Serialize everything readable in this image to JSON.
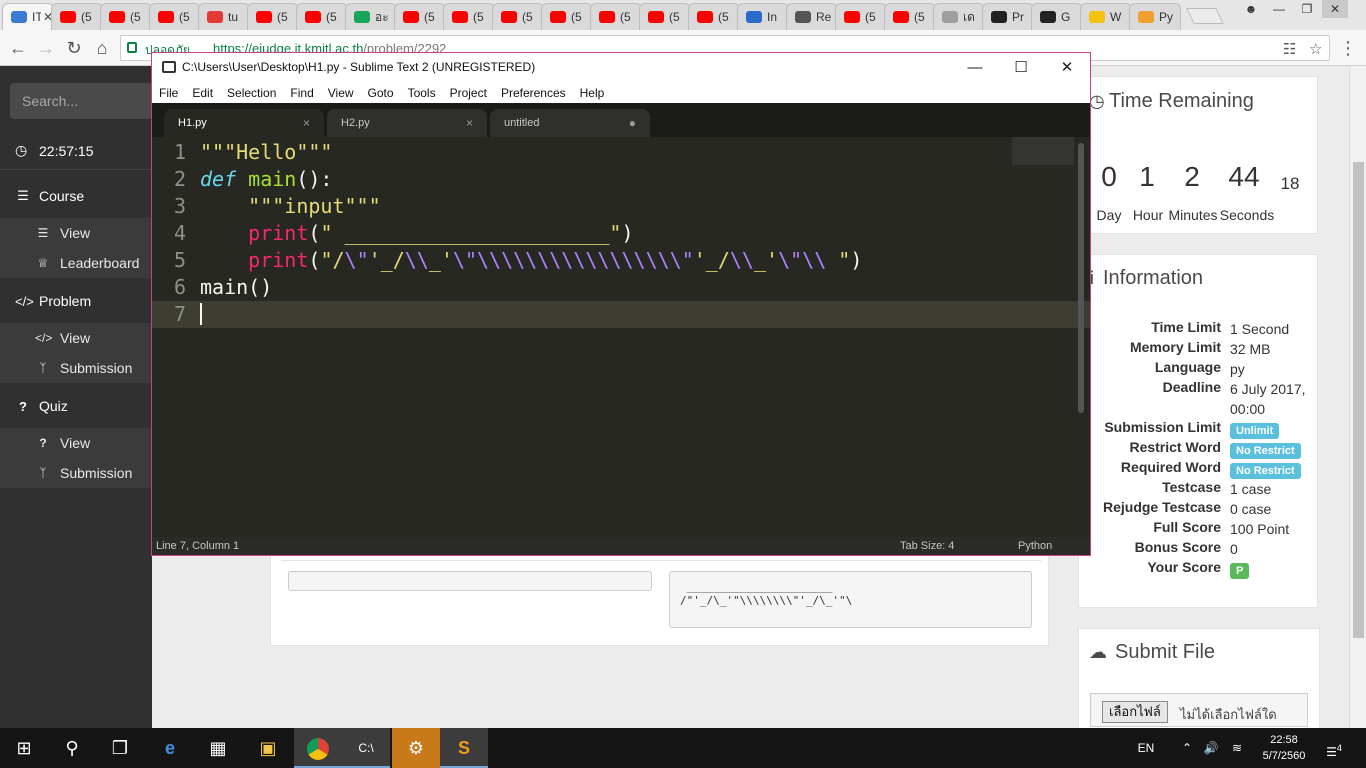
{
  "browser": {
    "tabs": [
      {
        "label": "IT",
        "icon": "it-favicon",
        "active": true,
        "color": "#3a7bd5"
      },
      {
        "label": "(5",
        "icon": "youtube-icon",
        "color": "#ff0000"
      },
      {
        "label": "(5",
        "icon": "youtube-icon",
        "color": "#ff0000"
      },
      {
        "label": "(5",
        "icon": "youtube-icon",
        "color": "#ff0000"
      },
      {
        "label": "tu",
        "icon": "pdf-icon",
        "color": "#e53935"
      },
      {
        "label": "(5",
        "icon": "youtube-icon",
        "color": "#ff0000"
      },
      {
        "label": "(5",
        "icon": "youtube-icon",
        "color": "#ff0000"
      },
      {
        "label": "อะ",
        "icon": "n-icon",
        "color": "#18a558"
      },
      {
        "label": "(5",
        "icon": "youtube-icon",
        "color": "#ff0000"
      },
      {
        "label": "(5",
        "icon": "youtube-icon",
        "color": "#ff0000"
      },
      {
        "label": "(5",
        "icon": "youtube-icon",
        "color": "#ff0000"
      },
      {
        "label": "(5",
        "icon": "youtube-icon",
        "color": "#ff0000"
      },
      {
        "label": "(5",
        "icon": "youtube-icon",
        "color": "#ff0000"
      },
      {
        "label": "(5",
        "icon": "youtube-icon",
        "color": "#ff0000"
      },
      {
        "label": "(5",
        "icon": "youtube-icon",
        "color": "#ff0000"
      },
      {
        "label": "In",
        "icon": "ox-icon",
        "color": "#2a6ac8"
      },
      {
        "label": "Re",
        "icon": "reader-icon",
        "color": "#555555"
      },
      {
        "label": "(5",
        "icon": "youtube-icon",
        "color": "#ff0000"
      },
      {
        "label": "(5",
        "icon": "youtube-icon",
        "color": "#ff0000"
      },
      {
        "label": "เด",
        "icon": "document-icon",
        "color": "#9e9e9e"
      },
      {
        "label": "Pr",
        "icon": "github-icon",
        "color": "#222222"
      },
      {
        "label": "G",
        "icon": "github-icon",
        "color": "#222222"
      },
      {
        "label": "W",
        "icon": "emoji-icon",
        "color": "#f4c20d"
      },
      {
        "label": "Py",
        "icon": "python-icon",
        "color": "#f0a030"
      }
    ],
    "secure_label": "ปลอดภัย",
    "url_host": "https://ejudge.it.kmitl.ac.th",
    "url_path": "/problem/2292"
  },
  "sidebar": {
    "search_placeholder": "Search...",
    "clock": "22:57:15",
    "sections": [
      {
        "label": "Course",
        "icon": "list-icon",
        "items": [
          {
            "label": "View",
            "icon": "list-icon"
          },
          {
            "label": "Leaderboard",
            "icon": "trophy-icon"
          }
        ]
      },
      {
        "label": "Problem",
        "icon": "code-icon",
        "items": [
          {
            "label": "View",
            "icon": "code-icon"
          },
          {
            "label": "Submission",
            "icon": "branch-icon"
          }
        ]
      },
      {
        "label": "Quiz",
        "icon": "question-icon",
        "items": [
          {
            "label": "View",
            "icon": "question-icon"
          },
          {
            "label": "Submission",
            "icon": "branch-icon"
          }
        ]
      }
    ]
  },
  "content": {
    "output_text": " ______________________\n/\"'_/\\_'\"\\\\\\\\\\\\\\\\\"'_/\\_'\"\\"
  },
  "time_remaining": {
    "title": "Time Remaining",
    "day": "0",
    "hour": "1",
    "minutes": "2",
    "seconds": "44",
    "small": "18",
    "day_label": "Day",
    "hour_label": "Hour",
    "minutes_label": "Minutes",
    "seconds_label": "Seconds"
  },
  "information": {
    "title": "Information",
    "rows": [
      {
        "key": "Time Limit",
        "value": "1 Second"
      },
      {
        "key": "Memory Limit",
        "value": "32 MB"
      },
      {
        "key": "Language",
        "value": "py"
      },
      {
        "key": "Deadline",
        "value": "6 July 2017,",
        "value2": "00:00"
      },
      {
        "key": "Submission Limit",
        "badge": "Unlimit"
      },
      {
        "key": "Restrict Word",
        "badge": "No Restrict"
      },
      {
        "key": "Required Word",
        "badge": "No Restrict"
      },
      {
        "key": "Testcase",
        "value": "1 case"
      },
      {
        "key": "Rejudge Testcase",
        "value": "0 case"
      },
      {
        "key": "Full Score",
        "value": "100 Point"
      },
      {
        "key": "Bonus Score",
        "value": "0"
      },
      {
        "key": "Your Score",
        "badge_green": "P"
      }
    ]
  },
  "submit": {
    "title": "Submit File",
    "choose_button": "เลือกไฟล์",
    "no_file": "ไม่ได้เลือกไฟล์ใด"
  },
  "sublime": {
    "title": "C:\\Users\\User\\Desktop\\H1.py - Sublime Text 2 (UNREGISTERED)",
    "menu": [
      "File",
      "Edit",
      "Selection",
      "Find",
      "View",
      "Goto",
      "Tools",
      "Project",
      "Preferences",
      "Help"
    ],
    "tabs": [
      {
        "label": "H1.py",
        "close": "×",
        "active": true
      },
      {
        "label": "H2.py",
        "close": "×"
      },
      {
        "label": "untitled",
        "close": "●"
      }
    ],
    "line_numbers": [
      "1",
      "2",
      "3",
      "4",
      "5",
      "6",
      "7"
    ],
    "code": {
      "l1": "\"\"\"Hello\"\"\"",
      "l2_kw": "def",
      "l2_fn": "main",
      "l2_rest": "():",
      "l3": "\"\"\"input\"\"\"",
      "l4_bi": "print",
      "l4_open": "(",
      "l4_str": "\" ______________________\"",
      "l4_close": ")",
      "l5_bi": "print",
      "l5_open": "(",
      "l5_s1": "\"/",
      "l5_e1": "\\\"",
      "l5_s2": "'_/",
      "l5_e2": "\\\\",
      "l5_s3": "_'",
      "l5_e3": "\\\"\\\\\\\\\\\\\\\\\\\\\\\\\\\\\\\\\\\"",
      "l5_s4": "'_/",
      "l5_e4": "\\\\",
      "l5_s5": "_'",
      "l5_e5": "\\\"\\\\",
      "l5_s6": " \"",
      "l5_close": ")",
      "l6": "main()"
    },
    "status_left": "Line 7, Column 1",
    "status_tab": "Tab Size: 4",
    "status_lang": "Python",
    "colors": {
      "background": "#272822",
      "string": "#e6db74",
      "keyword": "#66d9ef",
      "builtin": "#f92672",
      "escape": "#ae81ff"
    }
  },
  "taskbar": {
    "language": "EN",
    "time": "22:58",
    "date": "5/7/2560",
    "notifications": "4"
  }
}
